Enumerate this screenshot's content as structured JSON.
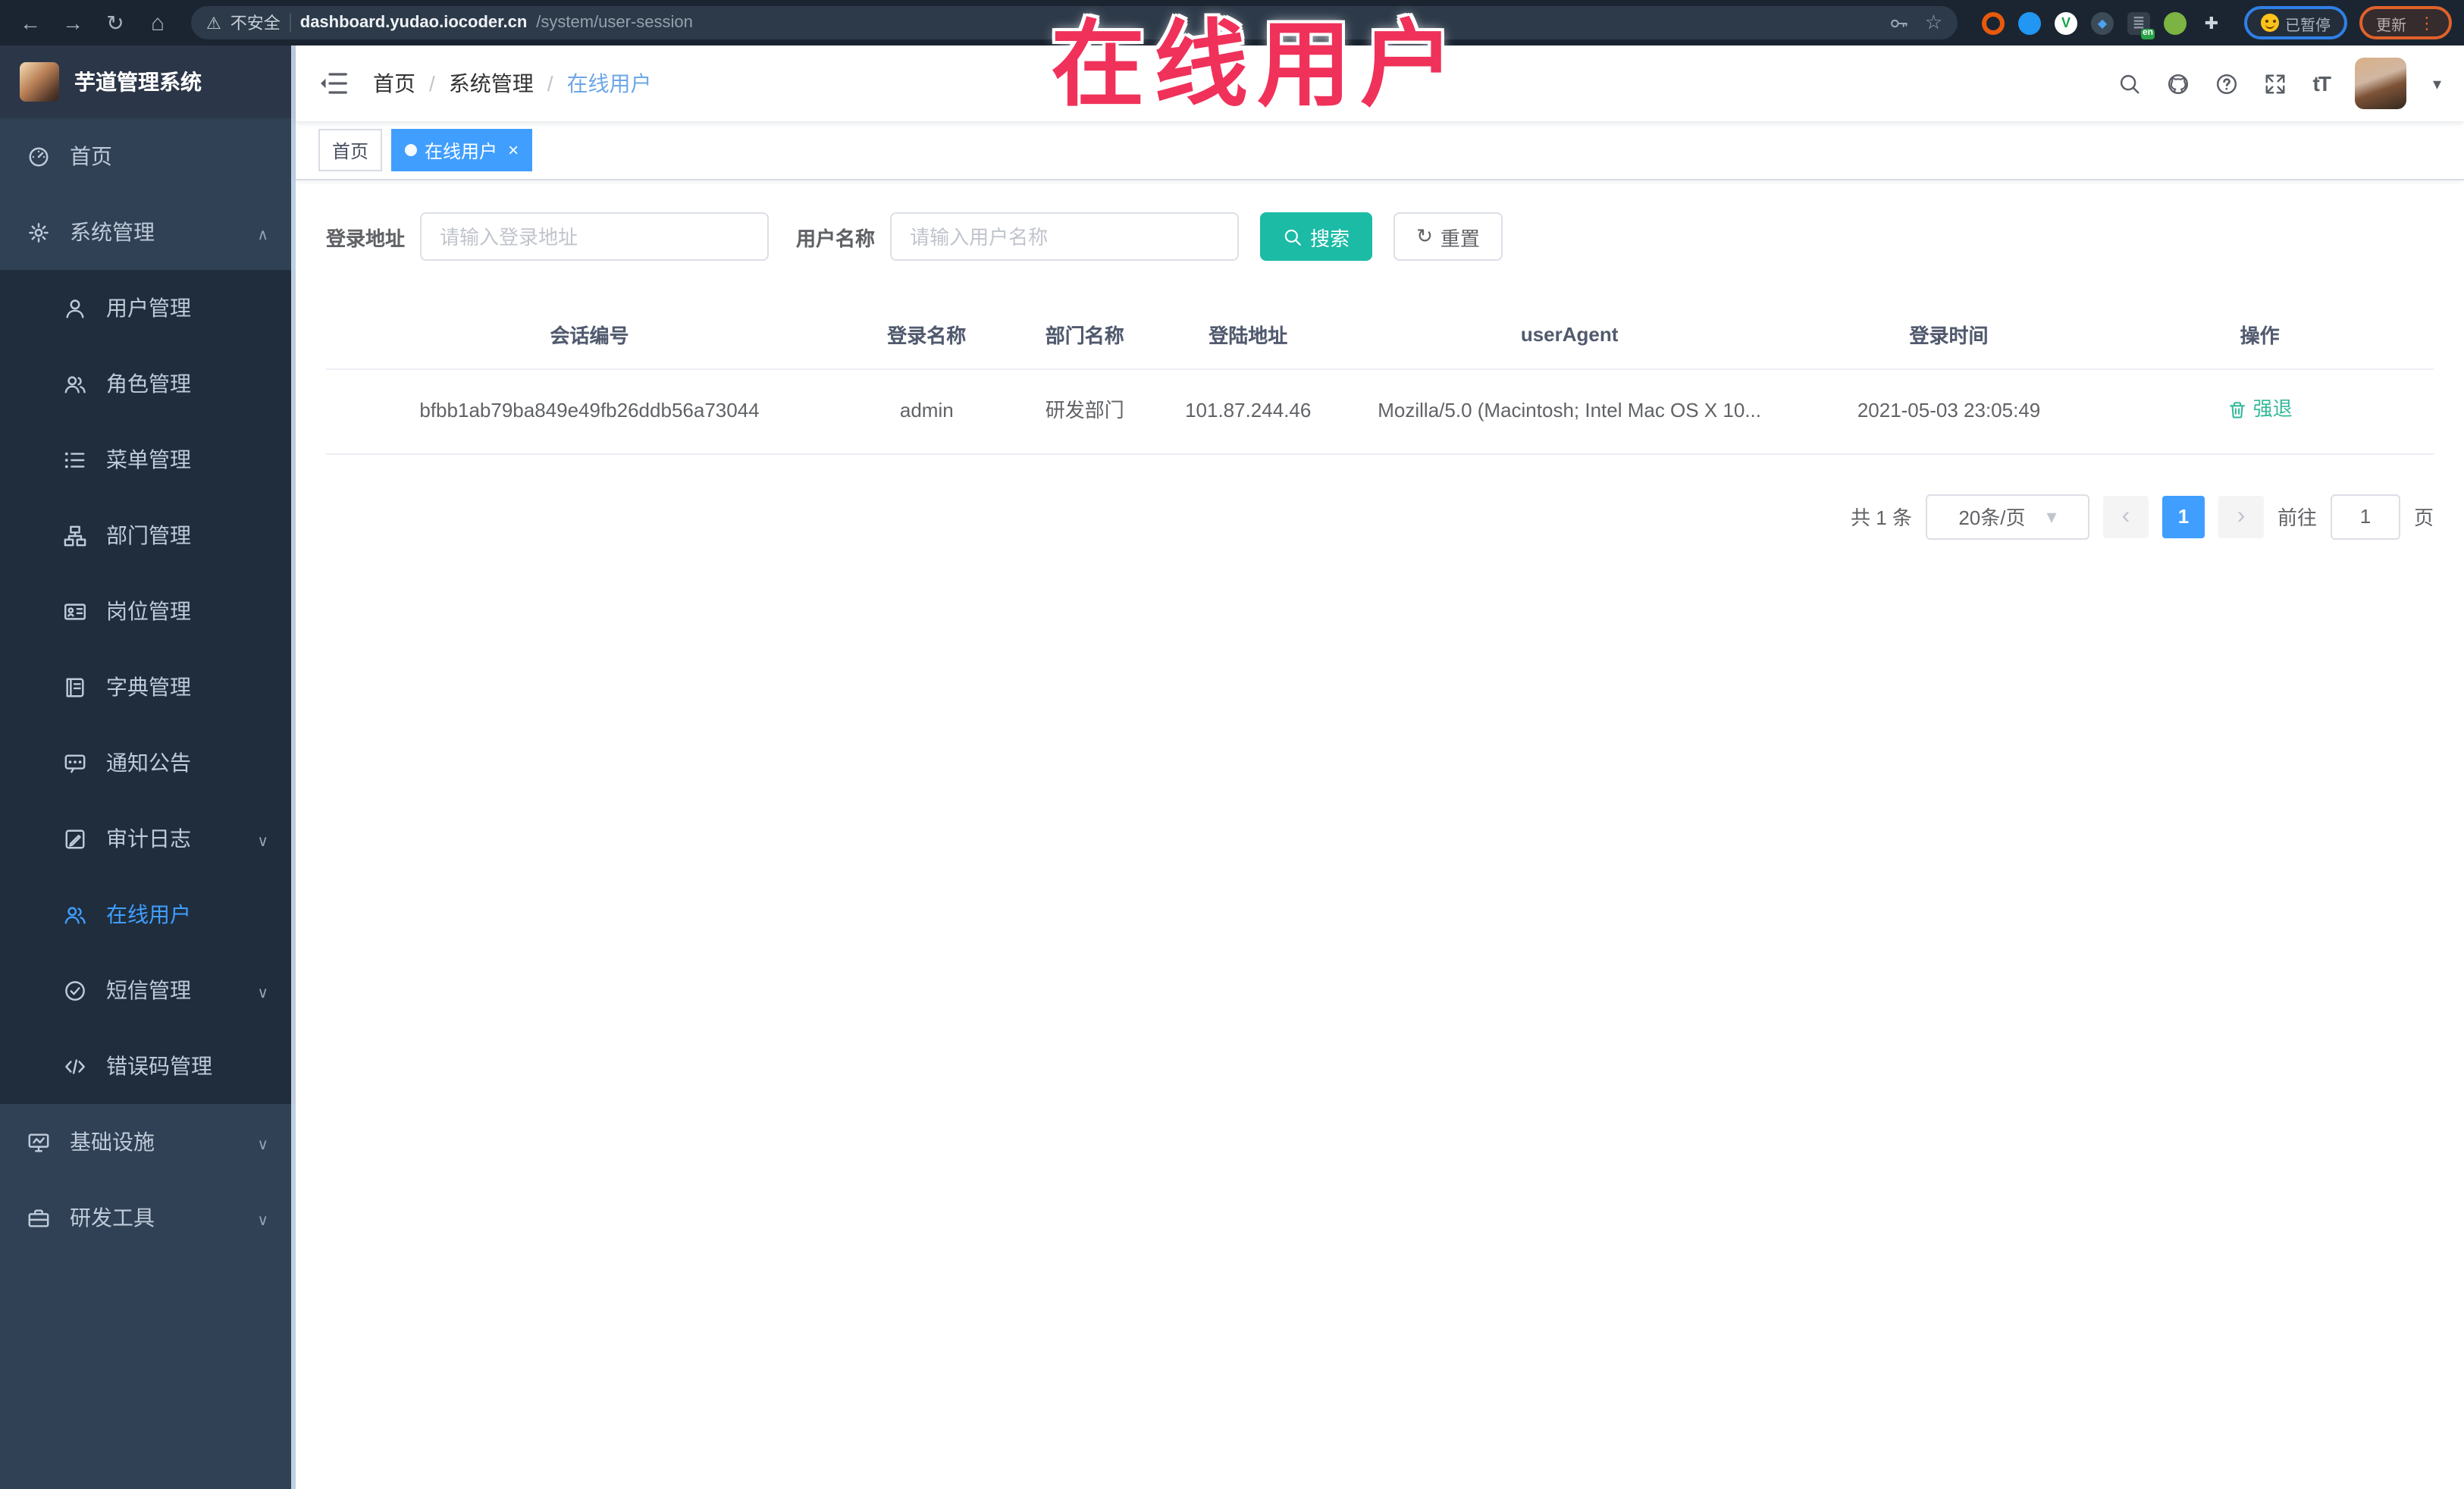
{
  "watermark": {
    "text": "在线用户",
    "color": "#f0315a"
  },
  "browser": {
    "security_label": "不安全",
    "url_host": "dashboard.yudao.iocoder.cn",
    "url_path": "/system/user-session",
    "translate_badge": "en",
    "paused_chip": "已暂停",
    "update_chip": "更新"
  },
  "sidebar": {
    "app_title": "芋道管理系统",
    "items": [
      {
        "label": "首页",
        "icon": "dashboard-icon"
      },
      {
        "label": "系统管理",
        "icon": "gear-icon",
        "chevron": "up",
        "expanded": true
      },
      {
        "label": "用户管理",
        "icon": "user-icon"
      },
      {
        "label": "角色管理",
        "icon": "users-icon"
      },
      {
        "label": "菜单管理",
        "icon": "menu-list-icon"
      },
      {
        "label": "部门管理",
        "icon": "org-tree-icon"
      },
      {
        "label": "岗位管理",
        "icon": "id-card-icon"
      },
      {
        "label": "字典管理",
        "icon": "book-icon"
      },
      {
        "label": "通知公告",
        "icon": "message-icon"
      },
      {
        "label": "审计日志",
        "icon": "log-icon",
        "chevron": "down"
      },
      {
        "label": "在线用户",
        "icon": "online-users-icon",
        "active": true
      },
      {
        "label": "短信管理",
        "icon": "sms-check-icon",
        "chevron": "down"
      },
      {
        "label": "错误码管理",
        "icon": "code-icon"
      },
      {
        "label": "基础设施",
        "icon": "infrastructure-icon",
        "chevron": "down"
      },
      {
        "label": "研发工具",
        "icon": "devtools-icon",
        "chevron": "down"
      }
    ]
  },
  "header": {
    "breadcrumb": [
      {
        "label": "首页"
      },
      {
        "label": "系统管理"
      },
      {
        "label": "在线用户"
      }
    ],
    "separator": "/"
  },
  "tabs": [
    {
      "label": "首页",
      "active": false
    },
    {
      "label": "在线用户",
      "active": true
    }
  ],
  "filters": {
    "login_address_label": "登录地址",
    "login_address_placeholder": "请输入登录地址",
    "username_label": "用户名称",
    "username_placeholder": "请输入用户名称",
    "search_label": "搜索",
    "reset_label": "重置"
  },
  "table": {
    "columns": [
      "会话编号",
      "登录名称",
      "部门名称",
      "登陆地址",
      "userAgent",
      "登录时间",
      "操作"
    ],
    "rows": [
      {
        "session_id": "bfbb1ab79ba849e49fb26ddb56a73044",
        "login_name": "admin",
        "dept_name": "研发部门",
        "login_ip": "101.87.244.46",
        "user_agent": "Mozilla/5.0 (Macintosh; Intel Mac OS X 10...",
        "login_time": "2021-05-03 23:05:49",
        "action": "强退"
      }
    ]
  },
  "pagination": {
    "total": "共 1 条",
    "page_size": "20条/页",
    "current_page": "1",
    "goto_label": "前往",
    "goto_value": "1",
    "page_suffix": "页"
  },
  "colors": {
    "accent_blue": "#409eff",
    "teal_button": "#1cbba6",
    "sidebar_bg": "#304156",
    "submenu_bg": "#1f2d3d",
    "watermark_red": "#f0315a"
  }
}
